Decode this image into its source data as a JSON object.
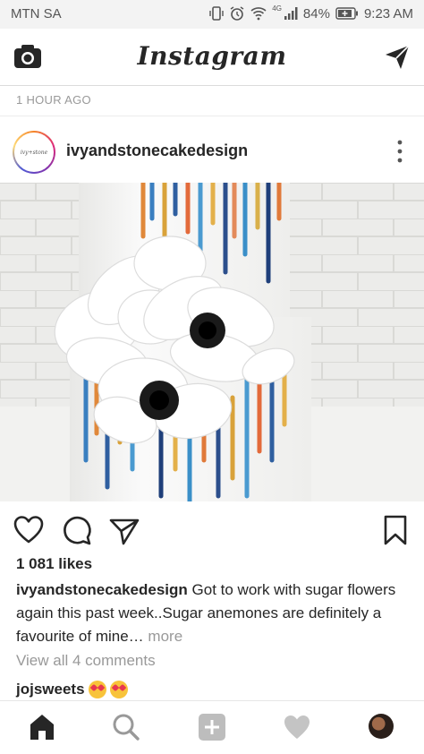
{
  "status_bar": {
    "carrier": "MTN SA",
    "network": "4G",
    "battery": "84%",
    "time": "9:23 AM"
  },
  "header": {
    "brand": "Instagram"
  },
  "previous_post": {
    "time_ago": "1 HOUR AGO"
  },
  "post": {
    "username": "ivyandstonecakedesign",
    "likes": "1 081 likes",
    "caption_user": "ivyandstonecakedesign",
    "caption_text": " Got to work with sugar flowers again this past week..Sugar anemones are definitely a favourite of mine…",
    "caption_more": " more",
    "view_comments": "View all 4 comments",
    "comment_user": "jojsweets"
  },
  "icons": {
    "camera": "camera-icon",
    "direct": "paper-plane-icon",
    "like": "heart-icon",
    "comment": "comment-icon",
    "share": "share-icon",
    "save": "bookmark-icon",
    "more": "more-vertical-icon",
    "home": "home-icon",
    "search": "search-icon",
    "add": "add-post-icon",
    "activity": "heart-icon"
  },
  "colors": {
    "text": "#262626",
    "muted": "#999999",
    "divider": "#dbdbdb"
  }
}
